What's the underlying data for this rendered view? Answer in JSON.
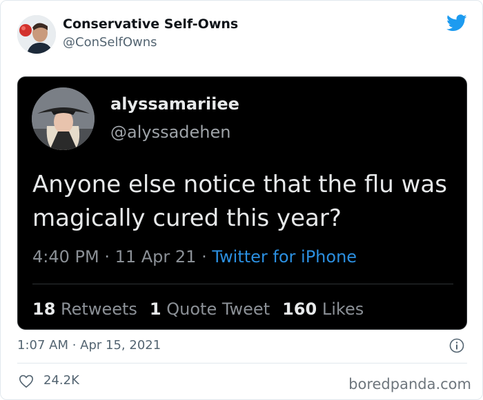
{
  "outer_tweet": {
    "display_name": "Conservative Self-Owns",
    "handle": "@ConSelfOwns",
    "timestamp": "1:07 AM · Apr 15, 2021",
    "likes": "24.2K",
    "icons": {
      "platform": "twitter-bird-icon",
      "info": "info-icon",
      "like": "heart-icon"
    },
    "brand_color": "#1d9bf0"
  },
  "embedded_tweet": {
    "display_name": "alyssamariiee",
    "handle": "@alyssadehen",
    "text": "Anyone else notice that the flu was magically cured this year?",
    "time": "4:40 PM",
    "date": "11 Apr 21",
    "source": "Twitter for iPhone",
    "separator": " · ",
    "stats": {
      "retweets_count": "18",
      "retweets_label": "Retweets",
      "quotes_count": "1",
      "quotes_label": "Quote Tweet",
      "likes_count": "160",
      "likes_label": "Likes"
    },
    "background_color": "#000000",
    "link_color": "#2b8fe0"
  },
  "watermark": "boredpanda.com"
}
